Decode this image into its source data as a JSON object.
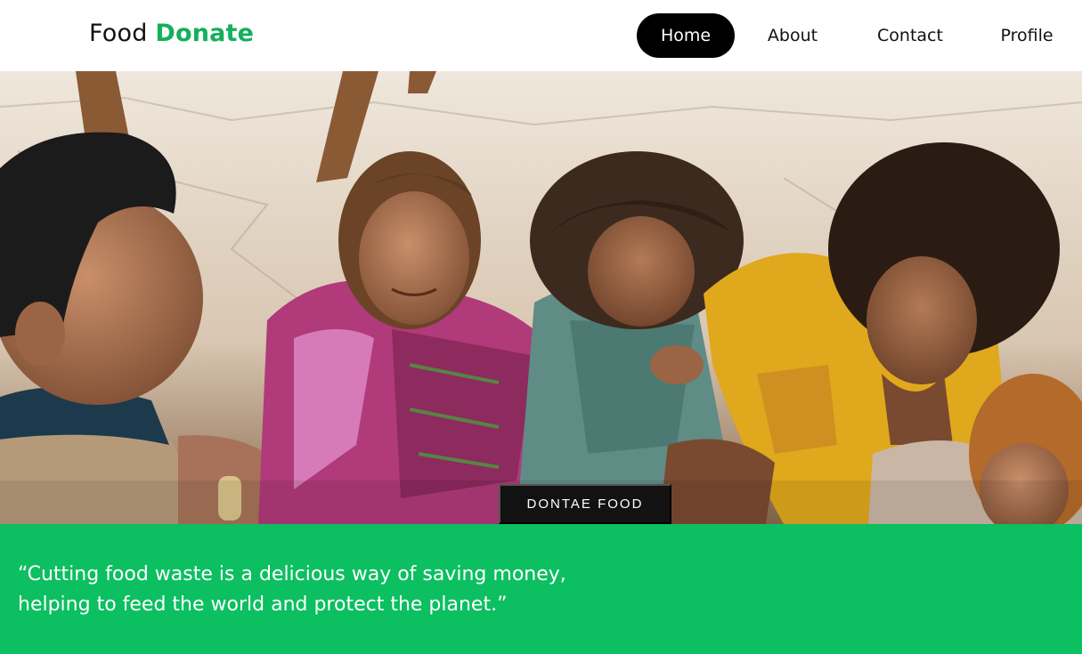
{
  "brand": {
    "part1": "Food",
    "part2": "Donate",
    "accent_color": "#12b05a"
  },
  "nav": {
    "items": [
      {
        "label": "Home",
        "active": true
      },
      {
        "label": "About",
        "active": false
      },
      {
        "label": "Contact",
        "active": false
      },
      {
        "label": "Profile",
        "active": false
      }
    ]
  },
  "hero": {
    "cta_label": "DONTAE FOOD"
  },
  "quote": {
    "line1": "“Cutting food waste is a delicious way of saving money,",
    "line2": "helping to feed the world and protect the planet.”",
    "background_color": "#0cbf61"
  }
}
